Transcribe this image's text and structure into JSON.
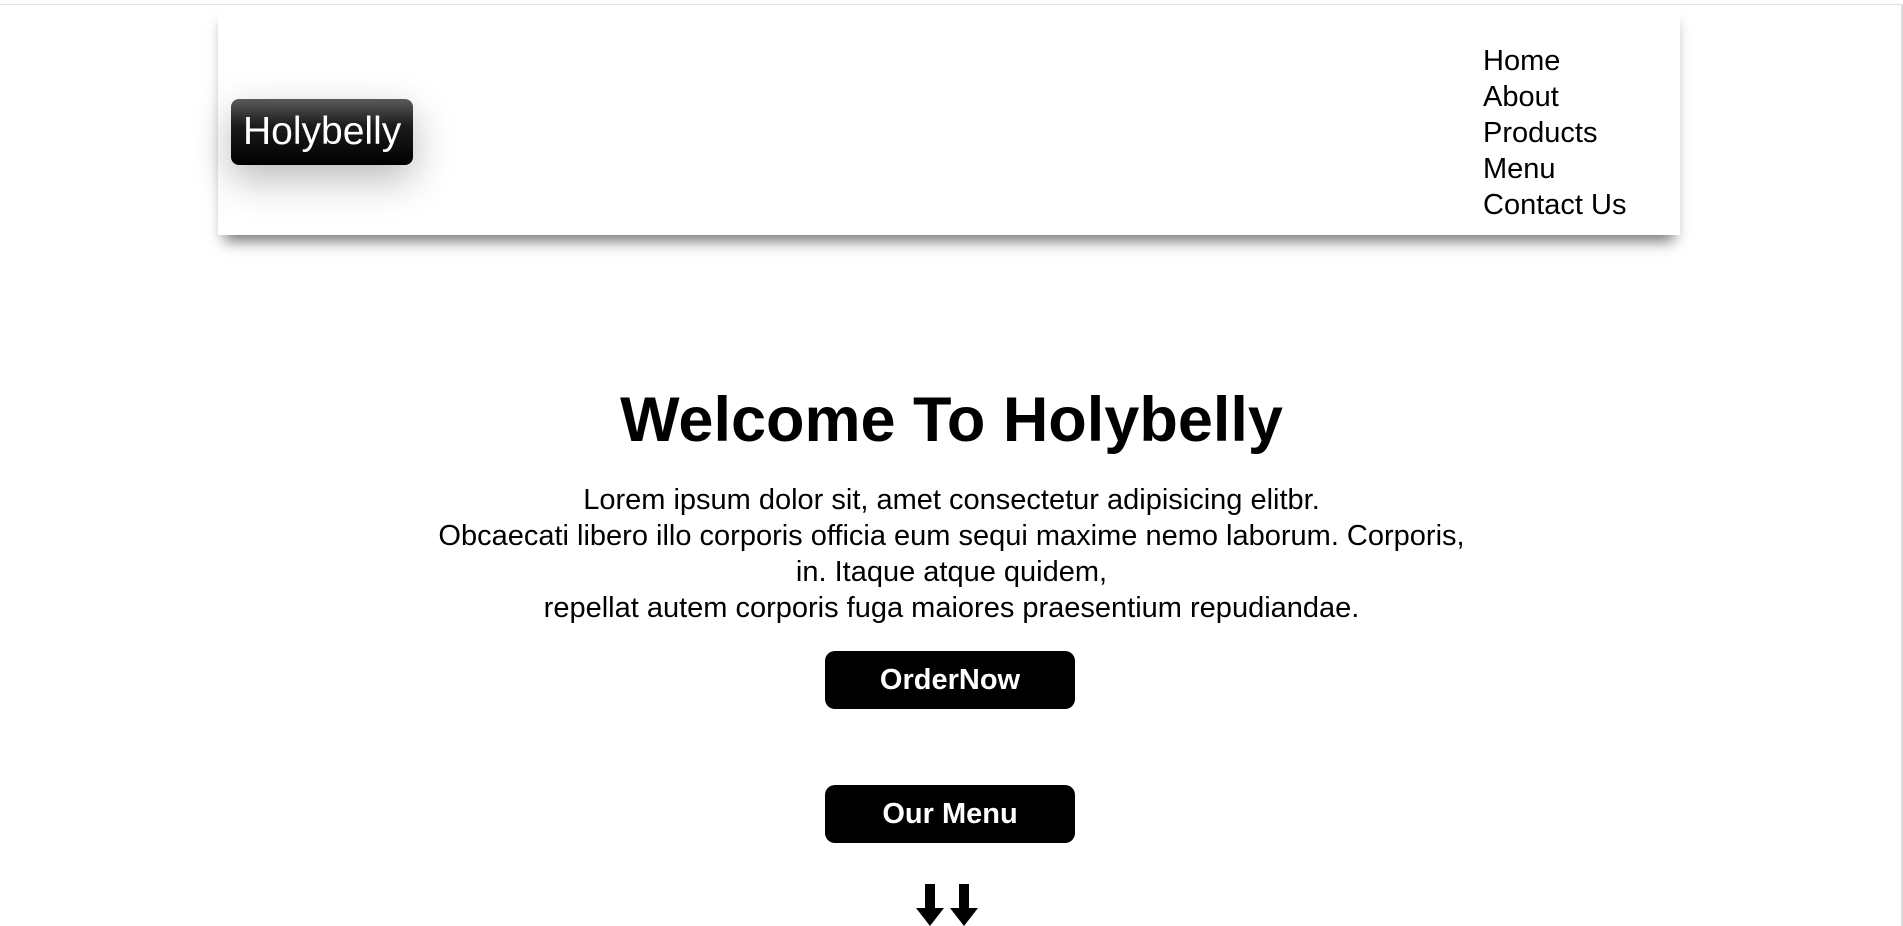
{
  "header": {
    "logo_text": "Holybelly",
    "nav": [
      "Home",
      "About",
      "Products",
      "Menu",
      "Contact Us"
    ]
  },
  "hero": {
    "title": "Welcome To Holybelly",
    "lines": [
      "Lorem ipsum dolor sit, amet consectetur adipisicing elitbr.",
      "Obcaecati libero illo corporis officia eum sequi maxime nemo laborum. Corporis,",
      "in. Itaque atque quidem,",
      "repellat autem corporis fuga maiores praesentium repudiandae."
    ],
    "order_button": "OrderNow",
    "menu_button": "Our Menu",
    "scroll_icon": "double-down-arrow-icon"
  },
  "colors": {
    "background": "#ffffff",
    "button": "#000000",
    "text": "#000000"
  }
}
